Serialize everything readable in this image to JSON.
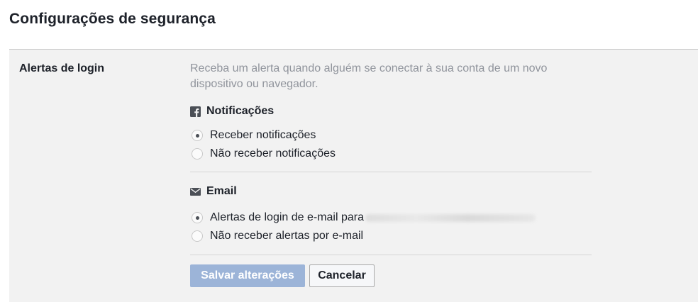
{
  "page": {
    "title": "Configurações de segurança"
  },
  "login_alerts": {
    "label": "Alertas de login",
    "description": "Receba um alerta quando alguém se conectar à sua conta de um novo dispositivo ou navegador.",
    "notifications": {
      "heading": "Notificações",
      "icon": "facebook-icon",
      "options": [
        {
          "label": "Receber notificações",
          "selected": true
        },
        {
          "label": "Não receber notificações",
          "selected": false
        }
      ]
    },
    "email": {
      "heading": "Email",
      "icon": "envelope-icon",
      "options": [
        {
          "label": "Alertas de login de e-mail para",
          "selected": true
        },
        {
          "label": "Não receber alertas por e-mail",
          "selected": false
        }
      ]
    },
    "buttons": {
      "save": "Salvar alterações",
      "cancel": "Cancelar"
    }
  },
  "colors": {
    "panel_bg": "#f2f2f2",
    "save_button_bg": "#9cb4d8",
    "description_text": "#90949c"
  }
}
